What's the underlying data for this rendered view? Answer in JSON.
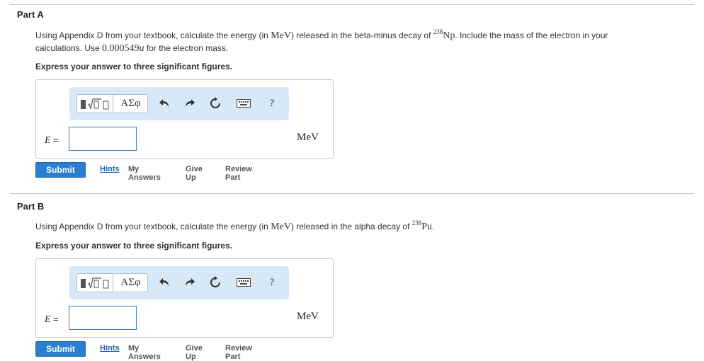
{
  "partA": {
    "title": "Part A",
    "q_line1_pre": "Using Appendix D from your textbook, calculate the energy (in ",
    "q_unit": "MeV",
    "q_line1_mid": ") released in the beta-minus decay of ",
    "q_iso_mass": "238",
    "q_iso_sym": "Np",
    "q_line1_post": ". Include the mass of the electron in your",
    "q_line2_pre": "calculations. Use ",
    "q_mass_value": "0.000549",
    "q_mass_unit": "u",
    "q_line2_post": " for the electron mass.",
    "instruction": "Express your answer to three significant figures.",
    "var_label": "E",
    "eq_sign": " =",
    "input_value": "",
    "unit": "MeV"
  },
  "partB": {
    "title": "Part B",
    "q_pre": "Using Appendix D from your textbook, calculate the energy (in ",
    "q_unit": "MeV",
    "q_mid": ") released in the alpha decay of ",
    "q_iso_mass": "238",
    "q_iso_sym": "Pu",
    "q_post": ".",
    "instruction": "Express your answer to three significant figures.",
    "var_label": "E",
    "eq_sign": " =",
    "input_value": "",
    "unit": "MeV"
  },
  "toolbar": {
    "greek_label": "ΑΣφ",
    "help_label": "?",
    "icons": [
      "templates-icon",
      "greek-symbols-icon",
      "undo-icon",
      "redo-icon",
      "reset-icon",
      "keyboard-icon",
      "help-icon"
    ]
  },
  "actions": {
    "submit": "Submit",
    "hints": "Hints",
    "my_answers": "My Answers",
    "give_up": "Give Up",
    "review_part": "Review Part"
  },
  "colors": {
    "submit_bg": "#2b7fd0",
    "toolbar_bg": "#d7e8f7",
    "input_border": "#3b7dc4",
    "link_blue": "#1f5fa8"
  }
}
